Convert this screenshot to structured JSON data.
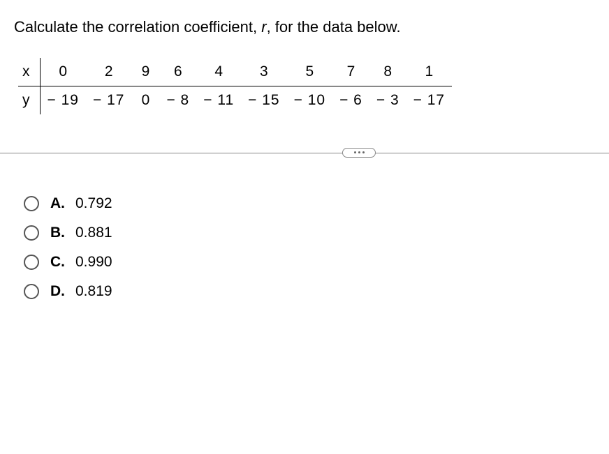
{
  "question": {
    "prefix": "Calculate the correlation coefficient, ",
    "var": "r",
    "suffix": ", for the data below."
  },
  "table": {
    "rows": [
      {
        "label": "x",
        "values": [
          "0",
          "2",
          "9",
          "6",
          "4",
          "3",
          "5",
          "7",
          "8",
          "1"
        ]
      },
      {
        "label": "y",
        "values": [
          "− 19",
          "− 17",
          "0",
          "− 8",
          "− 11",
          "− 15",
          "− 10",
          "− 6",
          "− 3",
          "− 17"
        ]
      }
    ]
  },
  "options": [
    {
      "letter": "A.",
      "value": "0.792"
    },
    {
      "letter": "B.",
      "value": "0.881"
    },
    {
      "letter": "C.",
      "value": "0.990"
    },
    {
      "letter": "D.",
      "value": "0.819"
    }
  ]
}
